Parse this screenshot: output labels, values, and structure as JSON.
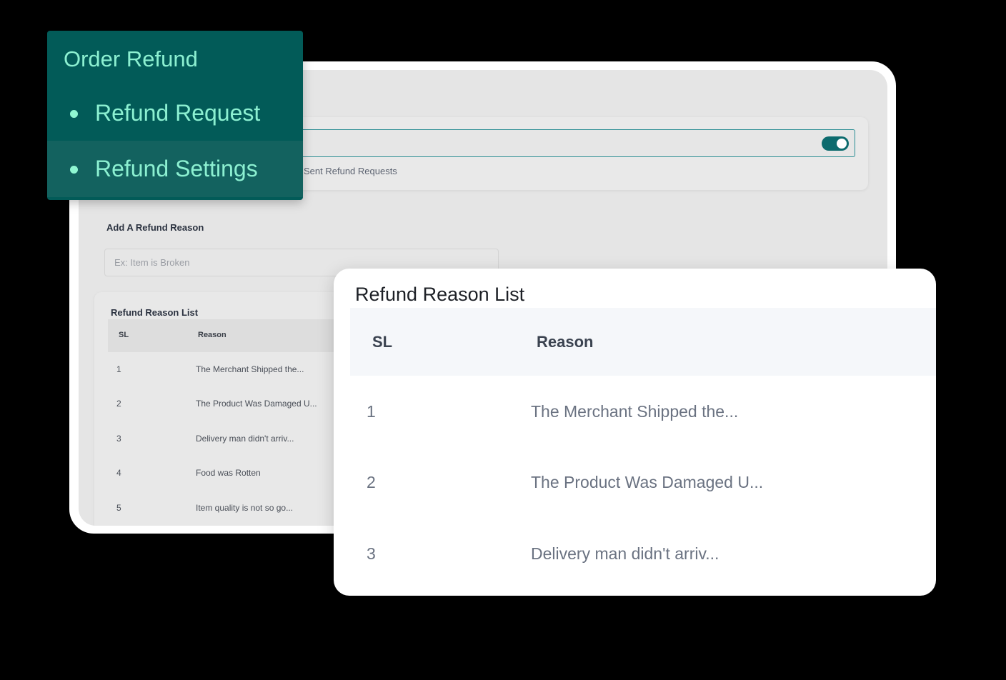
{
  "settings_panel": {
    "toggle_hint": "Sent Refund Requests",
    "add_reason": {
      "label": "Add A Refund Reason",
      "placeholder": "Ex: Item is Broken",
      "value": ""
    },
    "reason_list": {
      "title": "Refund Reason List",
      "columns": [
        "SL",
        "Reason"
      ],
      "rows": [
        {
          "sl": "1",
          "reason": "The Merchant Shipped the..."
        },
        {
          "sl": "2",
          "reason": "The Product Was Damaged U..."
        },
        {
          "sl": "3",
          "reason": "Delivery man didn't arriv..."
        },
        {
          "sl": "4",
          "reason": "Food was Rotten"
        },
        {
          "sl": "5",
          "reason": "Item quality is not so go..."
        }
      ]
    }
  },
  "menu": {
    "title": "Order Refund",
    "items": [
      {
        "label": "Refund Request"
      },
      {
        "label": "Refund Settings",
        "active": true
      }
    ]
  },
  "reason_card": {
    "title": "Refund Reason List",
    "columns": [
      "SL",
      "Reason"
    ],
    "rows": [
      {
        "sl": "1",
        "reason": "The Merchant Shipped the..."
      },
      {
        "sl": "2",
        "reason": "The Product Was Damaged U..."
      },
      {
        "sl": "3",
        "reason": "Delivery man didn't arriv..."
      }
    ]
  },
  "colors": {
    "brand_dark": "#025b58",
    "brand_active": "#13625f",
    "menu_text": "#8cf0d1",
    "toggle_on": "#0d6b6e"
  },
  "icons": {
    "bullet": "bullet-dot-icon",
    "toggle": "toggle-switch-icon"
  }
}
